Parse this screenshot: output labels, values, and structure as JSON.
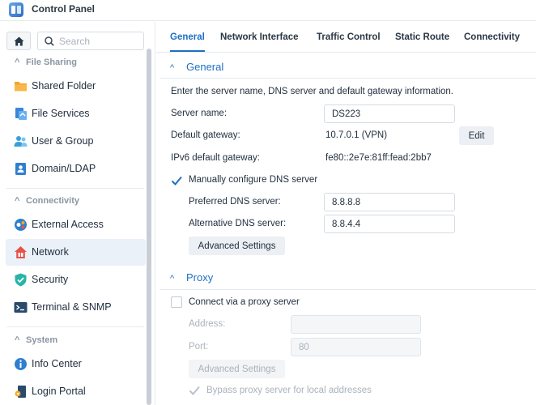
{
  "window": {
    "title": "Control Panel"
  },
  "sidebar": {
    "search_placeholder": "Search",
    "groups": [
      {
        "label": "File Sharing"
      },
      {
        "label": "Connectivity"
      },
      {
        "label": "System"
      }
    ],
    "items": [
      {
        "label": "Shared Folder",
        "icon": "folder-icon"
      },
      {
        "label": "File Services",
        "icon": "file-services-icon"
      },
      {
        "label": "User & Group",
        "icon": "users-icon"
      },
      {
        "label": "Domain/LDAP",
        "icon": "domain-icon"
      },
      {
        "label": "External Access",
        "icon": "external-access-icon"
      },
      {
        "label": "Network",
        "icon": "network-icon",
        "selected": true
      },
      {
        "label": "Security",
        "icon": "shield-icon"
      },
      {
        "label": "Terminal & SNMP",
        "icon": "terminal-icon"
      },
      {
        "label": "Info Center",
        "icon": "info-icon"
      },
      {
        "label": "Login Portal",
        "icon": "login-portal-icon"
      }
    ]
  },
  "tabs": [
    {
      "label": "General",
      "active": true
    },
    {
      "label": "Network Interface"
    },
    {
      "label": "Traffic Control"
    },
    {
      "label": "Static Route"
    },
    {
      "label": "Connectivity"
    }
  ],
  "general": {
    "heading": "General",
    "description": "Enter the server name, DNS server and default gateway information.",
    "server_name_label": "Server name:",
    "server_name_value": "DS223",
    "default_gateway_label": "Default gateway:",
    "default_gateway_value": "10.7.0.1 (VPN)",
    "edit_label": "Edit",
    "ipv6_gateway_label": "IPv6 default gateway:",
    "ipv6_gateway_value": "fe80::2e7e:81ff:fead:2bb7",
    "manual_dns_label": "Manually configure DNS server",
    "manual_dns_checked": true,
    "preferred_dns_label": "Preferred DNS server:",
    "preferred_dns_value": "8.8.8.8",
    "alternative_dns_label": "Alternative DNS server:",
    "alternative_dns_value": "8.8.4.4",
    "advanced_settings_label": "Advanced Settings"
  },
  "proxy": {
    "heading": "Proxy",
    "connect_label": "Connect via a proxy server",
    "connect_checked": false,
    "address_label": "Address:",
    "address_value": "",
    "port_label": "Port:",
    "port_value": "80",
    "advanced_settings_label": "Advanced Settings",
    "bypass_label": "Bypass proxy server for local addresses",
    "bypass_checked": true
  },
  "colors": {
    "accent": "#1f6fc5",
    "selected_bg": "#ebf1f9",
    "muted": "#8a96a3"
  }
}
